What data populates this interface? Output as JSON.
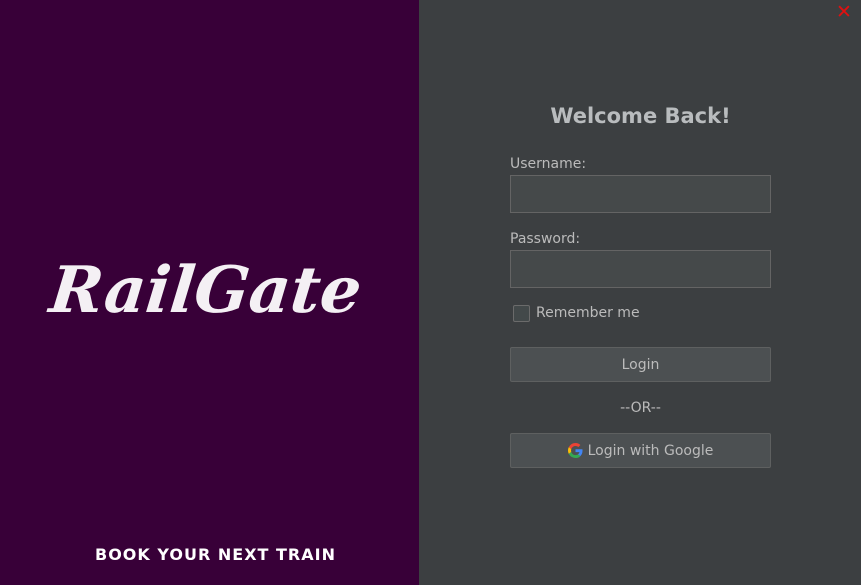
{
  "window": {
    "close_label": "✕"
  },
  "branding": {
    "logo_text": "RailGate",
    "tagline": "BOOK YOUR NEXT TRAIN"
  },
  "login": {
    "title": "Welcome Back!",
    "username_label": "Username:",
    "username_value": "",
    "password_label": "Password:",
    "password_value": "",
    "remember_label": "Remember me",
    "remember_checked": false,
    "login_button": "Login",
    "or_text": "--OR--",
    "google_button": "Login with Google",
    "google_icon": "google-g-icon"
  },
  "colors": {
    "left_panel": "#380038",
    "right_panel": "#3c3f41",
    "close": "#e01010",
    "text": "#bbbbbb"
  }
}
